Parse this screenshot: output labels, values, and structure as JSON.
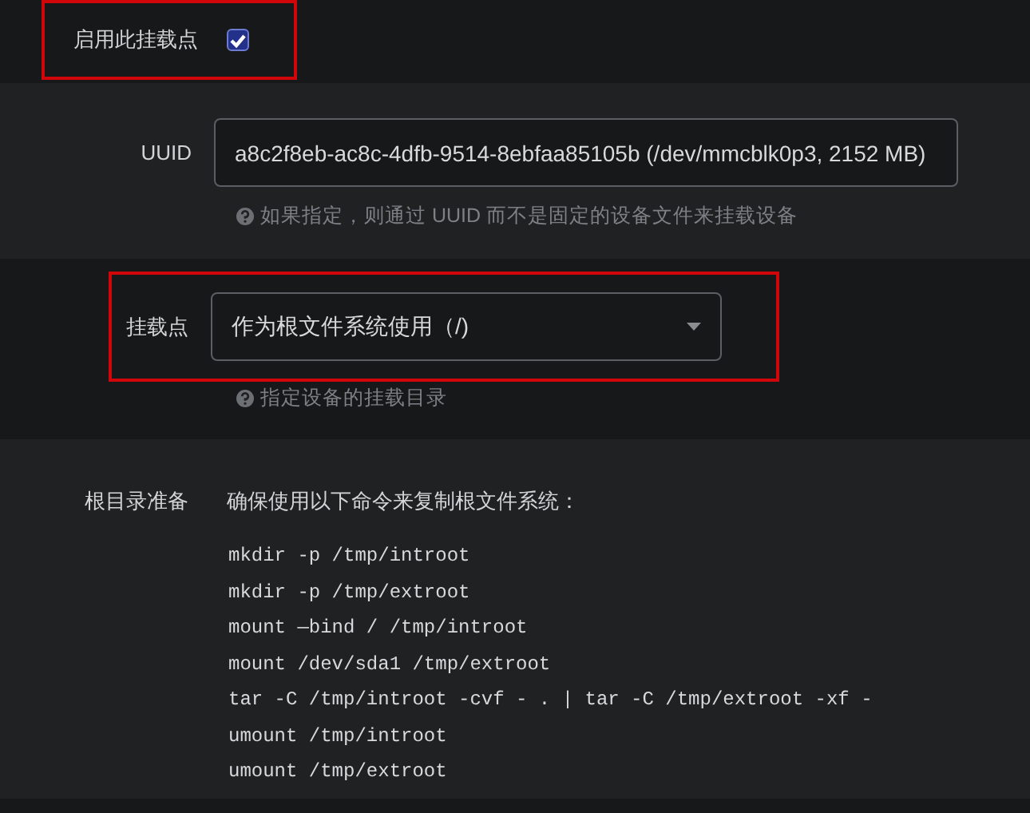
{
  "enable": {
    "label": "启用此挂载点",
    "checked": true,
    "highlighted": true
  },
  "uuid": {
    "label": "UUID",
    "value": "a8c2f8eb-ac8c-4dfb-9514-8ebfaa85105b (/dev/mmcblk0p3, 2152 MB)",
    "help": "如果指定，则通过 UUID 而不是固定的设备文件来挂载设备"
  },
  "mountpoint": {
    "label": "挂载点",
    "value": "作为根文件系统使用（/)",
    "help": "指定设备的挂载目录",
    "highlighted": true
  },
  "rootprep": {
    "label": "根目录准备",
    "intro": "确保使用以下命令来复制根文件系统：",
    "commands": [
      "mkdir -p /tmp/introot",
      "mkdir -p /tmp/extroot",
      "mount —bind / /tmp/introot",
      "mount /dev/sda1 /tmp/extroot",
      "tar -C /tmp/introot -cvf - . | tar -C /tmp/extroot -xf -",
      "umount /tmp/introot",
      "umount /tmp/extroot"
    ]
  }
}
